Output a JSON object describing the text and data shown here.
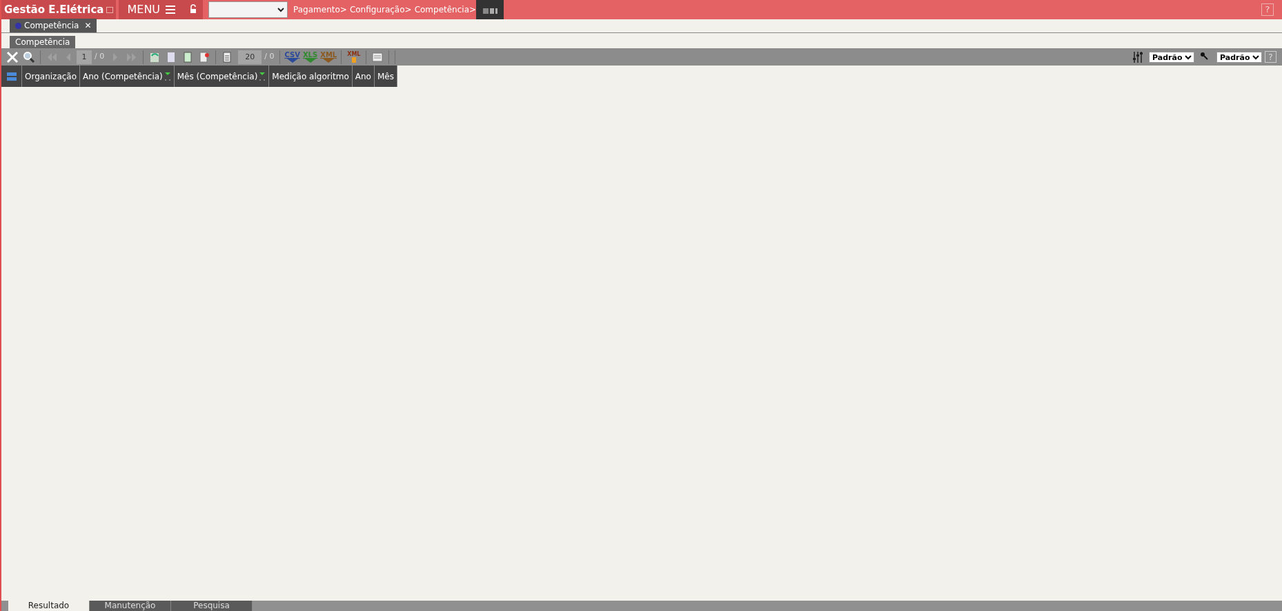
{
  "top_bar": {
    "app_title": "Gestão E.Elétrica",
    "menu_label": "MENU",
    "breadcrumb": [
      "Pagamento>",
      "Configuração>",
      "Competência>"
    ],
    "help": "?"
  },
  "open_tabs": [
    {
      "label": "Competência",
      "close": "✕",
      "selected": true
    }
  ],
  "section_tab": "Competência",
  "toolbar": {
    "page": "1",
    "page_total": "/ 0",
    "page_size": "20",
    "size_total": "/ 0",
    "exports": [
      {
        "label": "CSV",
        "color": "#2b4a9a"
      },
      {
        "label": "XLS",
        "color": "#2f8a2f"
      },
      {
        "label": "XML",
        "color": "#8a5a20"
      }
    ],
    "import_label": "XML",
    "selects": [
      "Padrão",
      "Padrão"
    ],
    "help": "?"
  },
  "table": {
    "columns": [
      {
        "label": "Organização",
        "sorted": false
      },
      {
        "label": "Ano (Competência)",
        "sorted": true
      },
      {
        "label": "Mês (Competência)",
        "sorted": true
      },
      {
        "label": "Medição algoritmo",
        "sorted": false
      },
      {
        "label": "Ano",
        "sorted": false
      },
      {
        "label": "Mês",
        "sorted": false
      }
    ]
  },
  "bottom_tabs": [
    {
      "label": "Resultado",
      "selected": true
    },
    {
      "label": "Manutenção",
      "selected": false
    },
    {
      "label": "Pesquisa",
      "selected": false
    }
  ]
}
